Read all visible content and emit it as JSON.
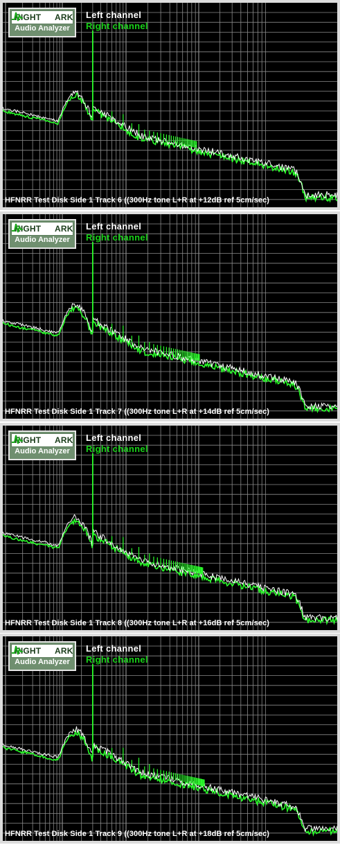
{
  "logo": {
    "word1": "RIGHT",
    "word2": "ARK",
    "sub": "Audio Analyzer"
  },
  "legend": {
    "left": "Left channel",
    "right": "Right channel"
  },
  "colors": {
    "left": "#ffffff",
    "right": "#2aff2a",
    "grid": "#8c8c8c",
    "plot_bg": "#000000"
  },
  "chart_data": [
    {
      "type": "line",
      "caption": "HFNRR Test Disk Side 1 Track 6 ((300Hz tone L+R at +12dB ref 5cm/sec)",
      "x_scale": "log",
      "grid": true,
      "legend_placement": "top-left",
      "series": [
        {
          "name": "Left channel",
          "color": "#ffffff"
        },
        {
          "name": "Right channel",
          "color": "#2aff2a"
        }
      ],
      "harmonics_visible": 31
    },
    {
      "type": "line",
      "caption": "HFNRR Test Disk Side 1 Track 7 ((300Hz tone L+R at +14dB ref 5cm/sec)",
      "x_scale": "log",
      "grid": true,
      "legend_placement": "top-left",
      "series": [
        {
          "name": "Left channel",
          "color": "#ffffff"
        },
        {
          "name": "Right channel",
          "color": "#2aff2a"
        }
      ],
      "harmonics_visible": 34
    },
    {
      "type": "line",
      "caption": "HFNRR Test Disk Side 1 Track 8 ((300Hz tone L+R at +16dB ref 5cm/sec)",
      "x_scale": "log",
      "grid": true,
      "legend_placement": "top-left",
      "series": [
        {
          "name": "Left channel",
          "color": "#ffffff"
        },
        {
          "name": "Right channel",
          "color": "#2aff2a"
        }
      ],
      "harmonics_visible": 38
    },
    {
      "type": "line",
      "caption": "HFNRR Test Disk Side 1 Track 9 ((300Hz tone L+R at +18dB ref 5cm/sec)",
      "x_scale": "log",
      "grid": true,
      "legend_placement": "top-left",
      "series": [
        {
          "name": "Left channel",
          "color": "#ffffff"
        },
        {
          "name": "Right channel",
          "color": "#2aff2a"
        }
      ],
      "harmonics_visible": 40
    }
  ]
}
